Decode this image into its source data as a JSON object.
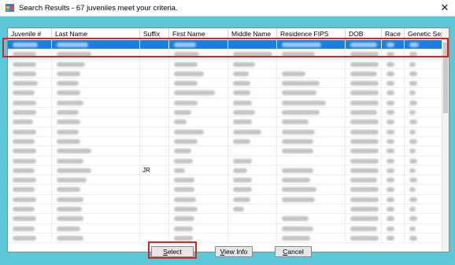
{
  "window": {
    "title": "Search Results - 67 juveniles meet your criteria.",
    "close_label": "✕"
  },
  "grid": {
    "columns": [
      {
        "label": "Juvenile #"
      },
      {
        "label": "Last Name"
      },
      {
        "label": "Suffix"
      },
      {
        "label": "First Name"
      },
      {
        "label": "Middle Name"
      },
      {
        "label": "Residence FIPS"
      },
      {
        "label": "DOB"
      },
      {
        "label": "Race"
      },
      {
        "label": "Genetic Sex"
      }
    ],
    "selected_row_index": 0,
    "visible_row_count": 21,
    "visible_suffix_text": "JR",
    "suffix_row_index": 13
  },
  "buttons": {
    "select": {
      "label": "Select",
      "mnemonic": "S"
    },
    "view_info": {
      "label": "View Info",
      "mnemonic": "V"
    },
    "cancel": {
      "label": "Cancel",
      "mnemonic": "C"
    }
  },
  "colors": {
    "window_background": "#5bc8d8",
    "selection_highlight": "#1c7fde",
    "annotation_outline": "#dd2222"
  }
}
